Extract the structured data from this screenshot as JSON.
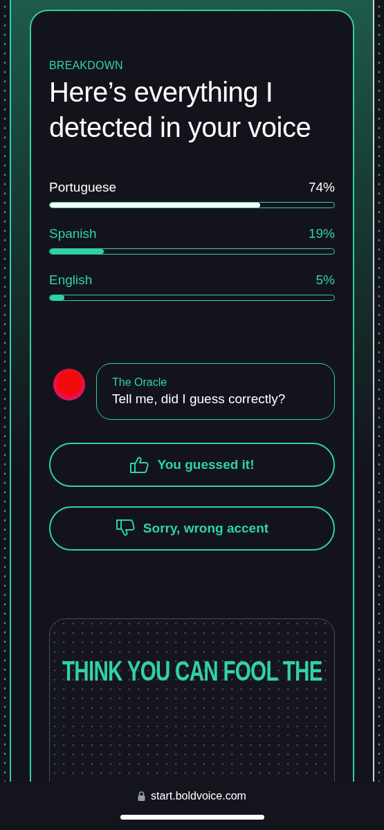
{
  "breakdown": {
    "eyebrow": "BREAKDOWN",
    "title": "Here’s everything I detected in your voice",
    "languages": [
      {
        "name": "Portuguese",
        "percent": "74%",
        "level": 0.74,
        "highlighted": true
      },
      {
        "name": "Spanish",
        "percent": "19%",
        "level": 0.19,
        "highlighted": false
      },
      {
        "name": "English",
        "percent": "5%",
        "level": 0.05,
        "highlighted": false
      }
    ]
  },
  "chat": {
    "sender": "The Oracle",
    "message": "Tell me, did I guess correctly?"
  },
  "buttons": [
    {
      "label": "You guessed it!",
      "kind": "thumbs_up"
    },
    {
      "label": "Sorry, wrong accent",
      "kind": "thumbs_down"
    }
  ],
  "promo": {
    "heading": "THINK YOU CAN FOOL THE"
  },
  "browser_bar": {
    "url": "start.boldvoice.com"
  }
}
